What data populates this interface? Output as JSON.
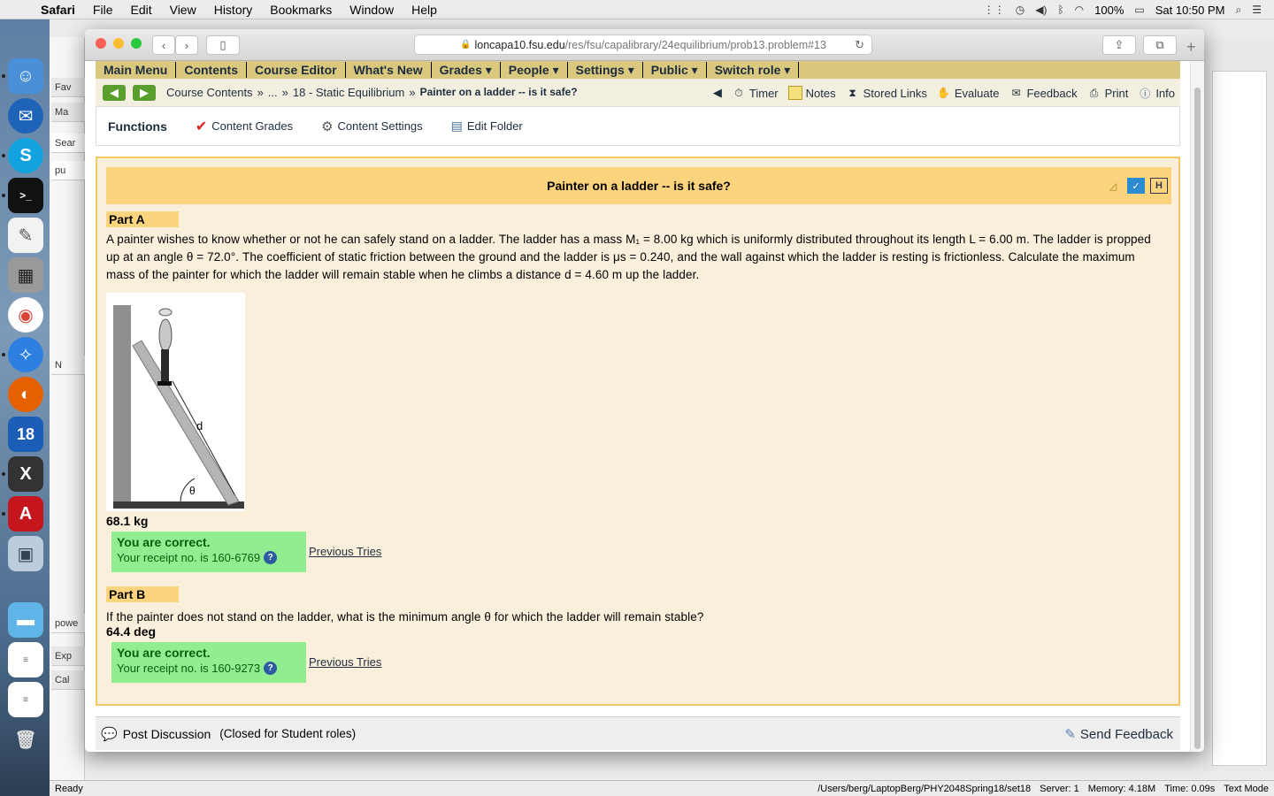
{
  "menubar": {
    "app": "Safari",
    "items": [
      "File",
      "Edit",
      "View",
      "History",
      "Bookmarks",
      "Window",
      "Help"
    ],
    "battery": "100%",
    "clock": "Sat 10:50 PM"
  },
  "browser": {
    "url_domain": "loncapa10.fsu.edu",
    "url_path": "/res/fsu/capalibrary/24equilibrium/prob13.problem#13"
  },
  "bg_window": {
    "sidebar_rows": [
      "Fav",
      "Ma",
      "Sear",
      "pu",
      "N",
      "powe",
      "Exp",
      "Cal"
    ],
    "status_left": "Ready",
    "status_right": [
      "/Users/berg/LaptopBerg/PHY2048Spring18/set18",
      "Server: 1",
      "Memory: 4.18M",
      "Time: 0.09s",
      "Text Mode"
    ]
  },
  "lonca": {
    "main_menu": [
      "Main Menu",
      "Contents",
      "Course Editor",
      "What's New",
      "Grades ▾",
      "People ▾",
      "Settings ▾",
      "Public ▾",
      "Switch role ▾"
    ],
    "breadcrumb": {
      "root": "Course Contents",
      "sep1": "»",
      "ellipsis": "...",
      "sep2": "»",
      "folder": "18 - Static Equilibrium",
      "sep3": "»",
      "current": "Painter on a ladder -- is it safe?"
    },
    "tools": {
      "timer": "Timer",
      "notes": "Notes",
      "stored_links": "Stored Links",
      "evaluate": "Evaluate",
      "feedback": "Feedback",
      "print": "Print",
      "info": "Info"
    },
    "functions": {
      "title": "Functions",
      "content_grades": "Content Grades",
      "content_settings": "Content Settings",
      "edit_folder": "Edit Folder"
    },
    "problem": {
      "title": "Painter on a ladder -- is it safe?",
      "part_a": {
        "label": "Part A",
        "text": "A painter wishes to know whether or not he can safely stand on a ladder. The ladder has a mass M₁ = 8.00 kg which is uniformly distributed throughout its length L = 6.00 m. The ladder is propped up at an angle θ = 72.0°. The coefficient of static friction between the ground and the ladder is μs = 0.240, and the wall against which the ladder is resting is frictionless. Calculate the maximum mass of the painter for which the ladder will remain stable when he climbs a distance d = 4.60 m up the ladder.",
        "figure_d": "d",
        "figure_theta": "θ",
        "answer": "68.1 kg",
        "correct": "You are correct.",
        "receipt": "Your receipt no. is 160-6769",
        "previous_tries": "Previous Tries"
      },
      "part_b": {
        "label": "Part B",
        "text": "If the painter does not stand on the ladder, what is the minimum angle θ for which the ladder will remain stable?",
        "answer": "64.4 deg",
        "correct": "You are correct.",
        "receipt": "Your receipt no. is 160-9273",
        "previous_tries": "Previous Tries"
      }
    },
    "discussion": {
      "post": "Post Discussion",
      "closed": "(Closed for Student roles)",
      "send_feedback": "Send Feedback"
    }
  },
  "colors": {
    "menu_gold": "#d9c87e",
    "title_gold": "#fcd47d",
    "problem_bg": "#faefdb",
    "correct_green": "#90ee90"
  }
}
